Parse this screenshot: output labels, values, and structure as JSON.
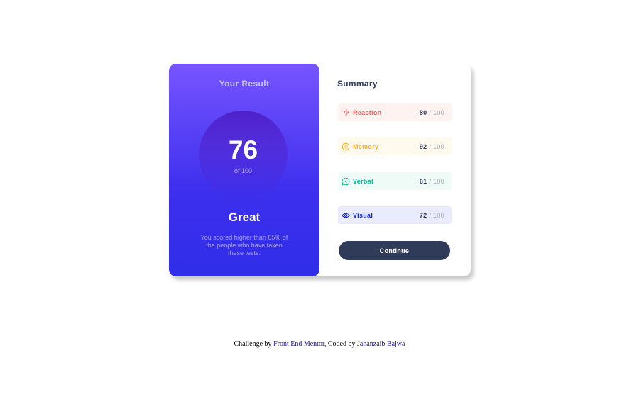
{
  "result": {
    "title": "Your Result",
    "score": "76",
    "of_label": "of 100",
    "grade": "Great",
    "description": "You scored higher than 65% of the people who have taken these tests."
  },
  "summary": {
    "title": "Summary",
    "items": [
      {
        "label": "Reaction",
        "score": "80",
        "max": "/ 100",
        "icon": "lightning-icon",
        "color": "#ff5757"
      },
      {
        "label": "Memory",
        "score": "92",
        "max": "/ 100",
        "icon": "brain-icon",
        "color": "#ffb01f"
      },
      {
        "label": "Verbal",
        "score": "61",
        "max": "/ 100",
        "icon": "chat-bubble-icon",
        "color": "#00bb8f"
      },
      {
        "label": "Visual",
        "score": "72",
        "max": "/ 100",
        "icon": "eye-icon",
        "color": "#1125d4"
      }
    ],
    "continue_label": "Continue"
  },
  "attribution": {
    "prefix": "Challenge by",
    "link1": "Front End Mentor",
    "middle": ", Coded by",
    "link2": "Jahanzaib Bajwa"
  },
  "colors": {
    "gradient_top": "#7755ff",
    "gradient_bottom": "#2f2ee9",
    "dark_navy": "#303b5a"
  }
}
